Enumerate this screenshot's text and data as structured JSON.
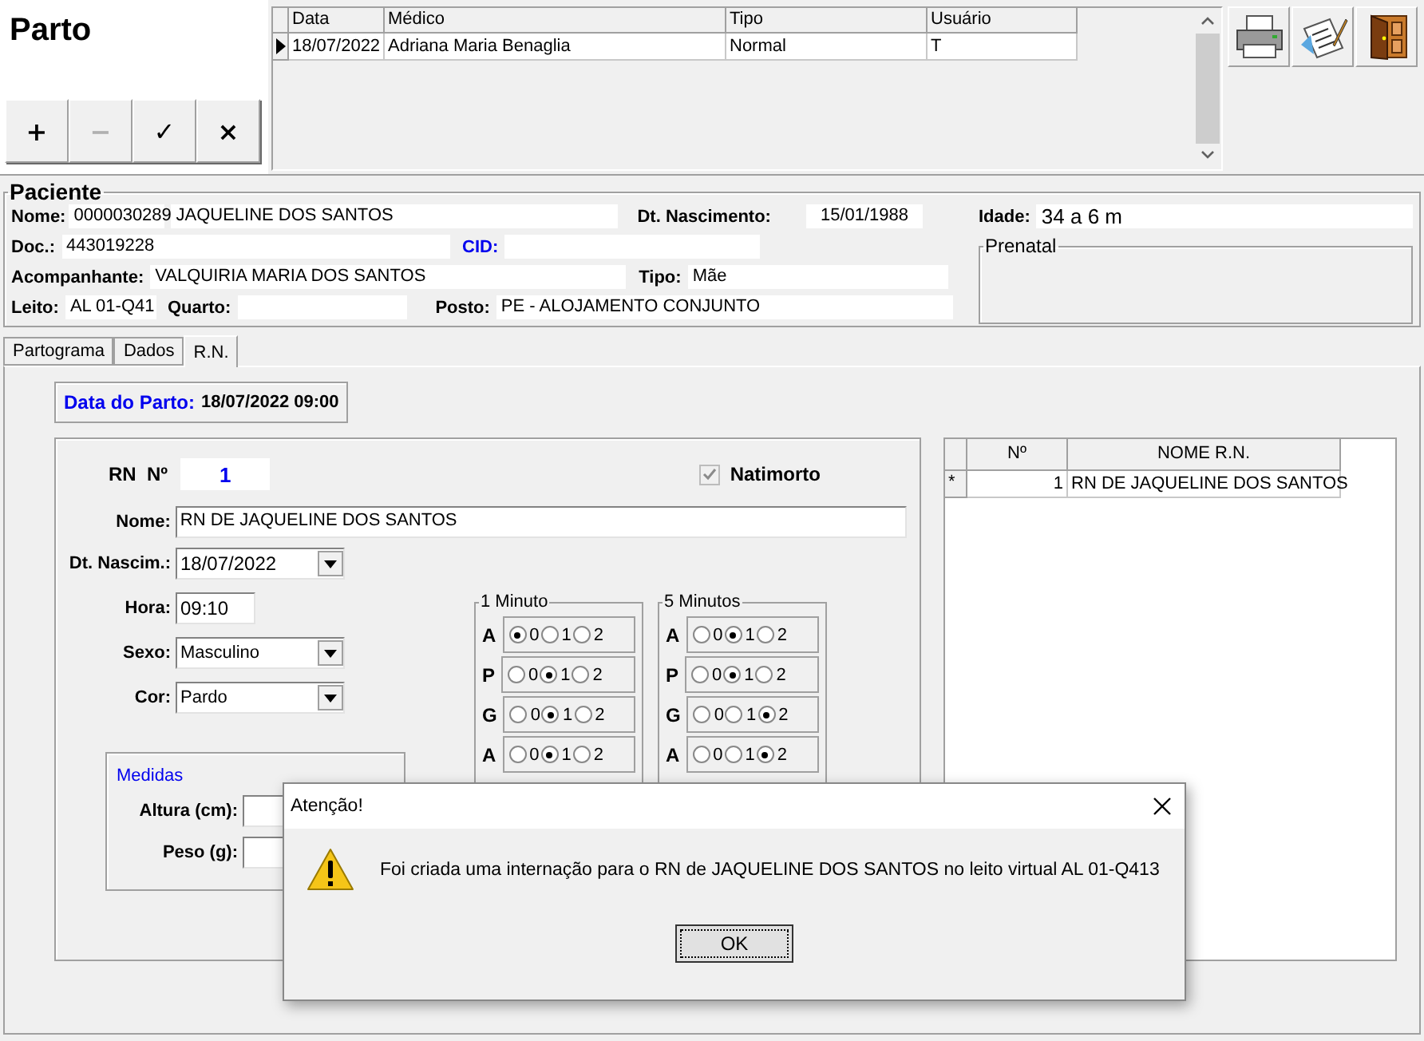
{
  "window": {
    "title": "Parto"
  },
  "toolbar": [
    {
      "label": "+",
      "disabled": false
    },
    {
      "label": "−",
      "disabled": true
    },
    {
      "label": "✓",
      "disabled": false
    },
    {
      "label": "×",
      "disabled": false
    }
  ],
  "history": {
    "columns": [
      "Data",
      "Médico",
      "Tipo",
      "Usuário"
    ],
    "rows": [
      {
        "current": true,
        "cells": [
          "18/07/2022",
          "Adriana Maria Benaglia",
          "Normal",
          "T"
        ]
      }
    ]
  },
  "paciente": {
    "title": "Paciente",
    "nome_label": "Nome:",
    "codigo": "0000030289",
    "nome": "JAQUELINE DOS SANTOS",
    "nascimento_label": "Dt. Nascimento:",
    "nascimento": "15/01/1988",
    "idade_label": "Idade:",
    "idade": "34 a 6 m",
    "doc_label": "Doc.:",
    "doc": "443019228",
    "cid_label": "CID:",
    "acompanhante_label": "Acompanhante:",
    "acompanhante": "VALQUIRIA MARIA DOS SANTOS",
    "tipo_label": "Tipo:",
    "tipo": "Mãe",
    "leito_label": "Leito:",
    "leito": "AL 01-Q41",
    "quarto_label": "Quarto:",
    "posto_label": "Posto:",
    "posto": "PE - ALOJAMENTO CONJUNTO",
    "prenatal_title": "Prenatal"
  },
  "tabs": [
    {
      "label": "Partograma",
      "selected": false
    },
    {
      "label": "Dados",
      "selected": false
    },
    {
      "label": "R.N.",
      "selected": true
    }
  ],
  "data_parto": {
    "label": "Data do Parto:",
    "value": "18/07/2022 09:00"
  },
  "rn": {
    "numero_label": "RN  Nº",
    "numero": "1",
    "natimorto": {
      "label": "Natimorto",
      "checked": true,
      "disabled": true
    },
    "nome_label": "Nome:",
    "nome": "RN DE JAQUELINE DOS SANTOS",
    "nascimento_label": "Dt. Nascim.:",
    "nascimento": "18/07/2022",
    "hora_label": "Hora:",
    "hora": "09:10",
    "sexo_label": "Sexo:",
    "sexo": "Masculino",
    "cor_label": "Cor:",
    "cor": "Pardo",
    "medidas": {
      "title": "Medidas",
      "altura_label": "Altura (cm):",
      "peso_label": "Peso (g):"
    }
  },
  "apgar": [
    {
      "title": "1 Minuto",
      "rows": [
        {
          "label": "A",
          "options": [
            {
              "label": "0",
              "selected": true
            },
            {
              "label": "1",
              "selected": false
            },
            {
              "label": "2",
              "selected": false
            }
          ]
        },
        {
          "label": "P",
          "options": [
            {
              "label": "0",
              "selected": false
            },
            {
              "label": "1",
              "selected": true
            },
            {
              "label": "2",
              "selected": false
            }
          ]
        },
        {
          "label": "G",
          "options": [
            {
              "label": "0",
              "selected": false
            },
            {
              "label": "1",
              "selected": true
            },
            {
              "label": "2",
              "selected": false
            }
          ]
        },
        {
          "label": "A",
          "options": [
            {
              "label": "0",
              "selected": false
            },
            {
              "label": "1",
              "selected": true
            },
            {
              "label": "2",
              "selected": false
            }
          ]
        }
      ]
    },
    {
      "title": "5 Minutos",
      "rows": [
        {
          "label": "A",
          "options": [
            {
              "label": "0",
              "selected": false
            },
            {
              "label": "1",
              "selected": true
            },
            {
              "label": "2",
              "selected": false
            }
          ]
        },
        {
          "label": "P",
          "options": [
            {
              "label": "0",
              "selected": false
            },
            {
              "label": "1",
              "selected": true
            },
            {
              "label": "2",
              "selected": false
            }
          ]
        },
        {
          "label": "G",
          "options": [
            {
              "label": "0",
              "selected": false
            },
            {
              "label": "1",
              "selected": false
            },
            {
              "label": "2",
              "selected": true
            }
          ]
        },
        {
          "label": "A",
          "options": [
            {
              "label": "0",
              "selected": false
            },
            {
              "label": "1",
              "selected": false
            },
            {
              "label": "2",
              "selected": true
            }
          ]
        }
      ]
    }
  ],
  "rn_list": {
    "columns": [
      "Nº",
      "NOME R.N."
    ],
    "rows": [
      {
        "indicator": "*",
        "numero": "1",
        "nome": "RN DE JAQUELINE DOS SANTOS"
      }
    ]
  },
  "dialog": {
    "title": "Atenção!",
    "message": "Foi criada uma internação para o RN de JAQUELINE DOS SANTOS no leito virtual AL 01-Q413",
    "button": "OK"
  }
}
